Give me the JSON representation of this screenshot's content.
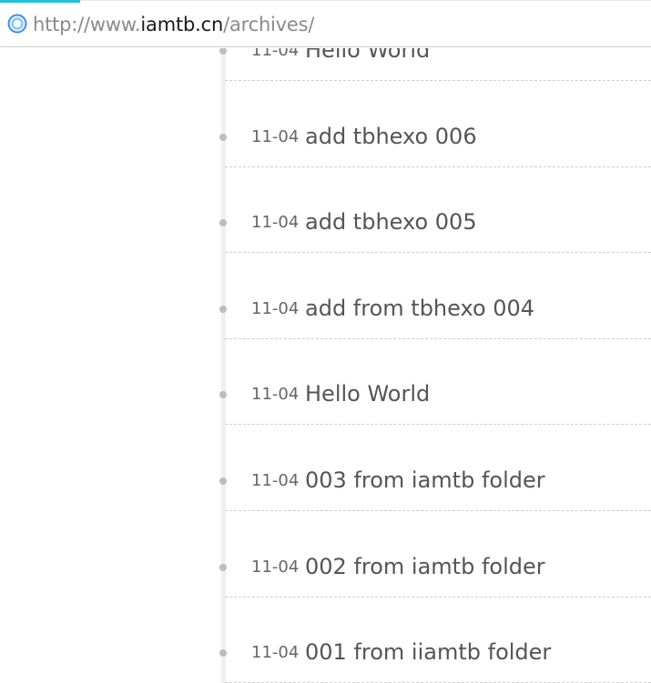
{
  "browser": {
    "url_scheme": "http://www.",
    "url_host": "iamtb.cn",
    "url_path": "/archives/",
    "accent_color": "#20c2d8"
  },
  "archive": {
    "posts": [
      {
        "date": "11-04",
        "title": "Hello World"
      },
      {
        "date": "11-04",
        "title": "add tbhexo 006"
      },
      {
        "date": "11-04",
        "title": "add tbhexo 005"
      },
      {
        "date": "11-04",
        "title": "add from tbhexo 004"
      },
      {
        "date": "11-04",
        "title": "Hello World"
      },
      {
        "date": "11-04",
        "title": "003 from iamtb folder"
      },
      {
        "date": "11-04",
        "title": "002 from iamtb folder"
      },
      {
        "date": "11-04",
        "title": "001 from iiamtb folder"
      }
    ]
  }
}
